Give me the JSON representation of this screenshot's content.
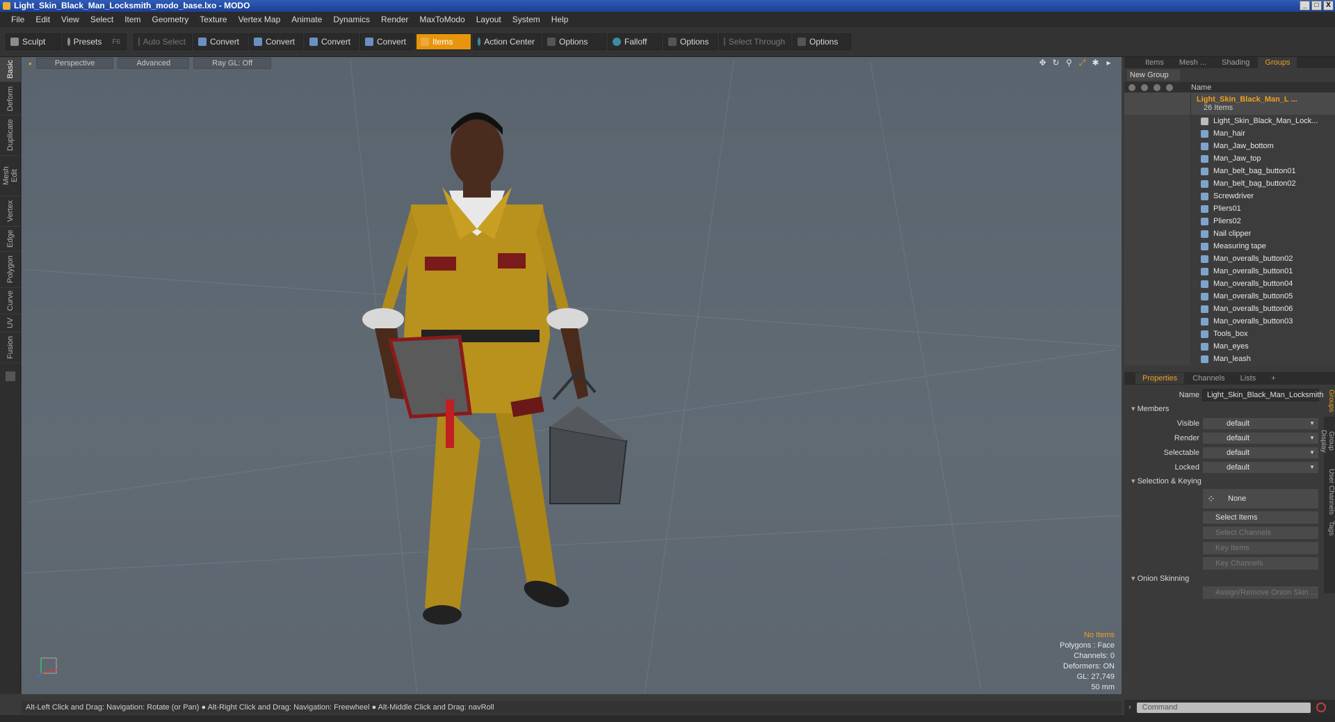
{
  "window": {
    "title": "Light_Skin_Black_Man_Locksmith_modo_base.lxo - MODO",
    "min": "_",
    "max": "□",
    "close": "X"
  },
  "menu": [
    "File",
    "Edit",
    "View",
    "Select",
    "Item",
    "Geometry",
    "Texture",
    "Vertex Map",
    "Animate",
    "Dynamics",
    "Render",
    "MaxToModo",
    "Layout",
    "System",
    "Help"
  ],
  "toolbar": {
    "sculpt": "Sculpt",
    "presets": "Presets",
    "presets_key": "F6",
    "auto_select": "Auto Select",
    "convert1": "Convert",
    "convert2": "Convert",
    "convert3": "Convert",
    "convert4": "Convert",
    "items": "Items",
    "action_center": "Action Center",
    "options1": "Options",
    "falloff": "Falloff",
    "options2": "Options",
    "select_through": "Select Through",
    "options3": "Options"
  },
  "left_tabs": [
    "Basic",
    "Deform",
    "Duplicate",
    "Mesh Edit",
    "Vertex",
    "Edge",
    "Polygon",
    "Curve",
    "UV",
    "Fusion"
  ],
  "viewport": {
    "view": "Perspective",
    "mode": "Advanced",
    "raygl": "Ray GL: Off",
    "stats": {
      "selection": "No Items",
      "polygons": "Polygons : Face",
      "channels": "Channels: 0",
      "deformers": "Deformers: ON",
      "gl": "GL: 27,749",
      "focal": "50 mm"
    }
  },
  "statusbar": "Alt-Left Click and Drag: Navigation: Rotate (or Pan) ● Alt-Right Click and Drag: Navigation: Freewheel ● Alt-Middle Click and Drag: navRoll",
  "outliner": {
    "tabs": [
      "Items",
      "Mesh ...",
      "Shading",
      "Groups"
    ],
    "new_group": "New Group",
    "name_col": "Name",
    "group_name": "Light_Skin_Black_Man_L ...",
    "group_count": "26 Items",
    "items": [
      "Light_Skin_Black_Man_Lock...",
      "Man_hair",
      "Man_Jaw_bottom",
      "Man_Jaw_top",
      "Man_belt_bag_button01",
      "Man_belt_bag_button02",
      "Screwdriver",
      "Pliers01",
      "Pliers02",
      "Nail clipper",
      "Measuring tape",
      "Man_overalls_button02",
      "Man_overalls_button01",
      "Man_overalls_button04",
      "Man_overalls_button05",
      "Man_overalls_button06",
      "Man_overalls_button03",
      "Tools_box",
      "Man_eyes",
      "Man_leash"
    ]
  },
  "properties": {
    "tabs": [
      "Properties",
      "Channels",
      "Lists",
      "+"
    ],
    "name_label": "Name",
    "name_value": "Light_Skin_Black_Man_Locksmith",
    "members": "Members",
    "visible_label": "Visible",
    "visible_value": "default",
    "render_label": "Render",
    "render_value": "default",
    "selectable_label": "Selectable",
    "selectable_value": "default",
    "locked_label": "Locked",
    "locked_value": "default",
    "selection_keying": "Selection & Keying",
    "none": "None",
    "select_items": "Select Items",
    "select_channels": "Select Channels",
    "key_items": "Key Items",
    "key_channels": "Key Channels",
    "onion_skinning": "Onion Skinning",
    "assign_onion": "Assign/Remove Onion Skin ...",
    "side_tabs": [
      "Groups",
      "Group Display",
      "User Channels",
      "Tags"
    ]
  },
  "command": {
    "placeholder": "Command"
  },
  "colors": {
    "accent": "#f0a020",
    "viewport_bg": "#5f6971",
    "overalls": "#b8921c"
  }
}
